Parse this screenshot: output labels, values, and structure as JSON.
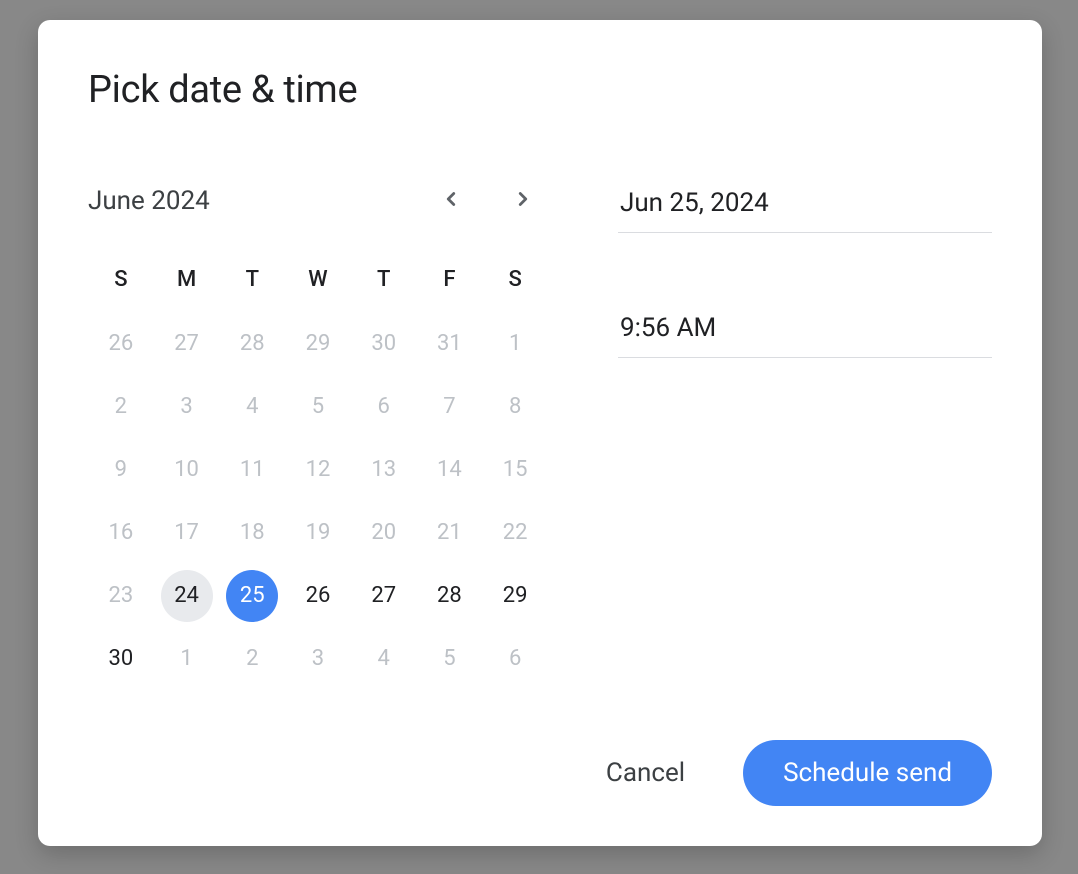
{
  "dialog": {
    "title": "Pick date & time"
  },
  "calendar": {
    "month_year": "June 2024",
    "day_headers": [
      "S",
      "M",
      "T",
      "W",
      "T",
      "F",
      "S"
    ],
    "days": [
      {
        "d": "26",
        "state": "muted"
      },
      {
        "d": "27",
        "state": "muted"
      },
      {
        "d": "28",
        "state": "muted"
      },
      {
        "d": "29",
        "state": "muted"
      },
      {
        "d": "30",
        "state": "muted"
      },
      {
        "d": "31",
        "state": "muted"
      },
      {
        "d": "1",
        "state": "muted"
      },
      {
        "d": "2",
        "state": "muted"
      },
      {
        "d": "3",
        "state": "muted"
      },
      {
        "d": "4",
        "state": "muted"
      },
      {
        "d": "5",
        "state": "muted"
      },
      {
        "d": "6",
        "state": "muted"
      },
      {
        "d": "7",
        "state": "muted"
      },
      {
        "d": "8",
        "state": "muted"
      },
      {
        "d": "9",
        "state": "muted"
      },
      {
        "d": "10",
        "state": "muted"
      },
      {
        "d": "11",
        "state": "muted"
      },
      {
        "d": "12",
        "state": "muted"
      },
      {
        "d": "13",
        "state": "muted"
      },
      {
        "d": "14",
        "state": "muted"
      },
      {
        "d": "15",
        "state": "muted"
      },
      {
        "d": "16",
        "state": "muted"
      },
      {
        "d": "17",
        "state": "muted"
      },
      {
        "d": "18",
        "state": "muted"
      },
      {
        "d": "19",
        "state": "muted"
      },
      {
        "d": "20",
        "state": "muted"
      },
      {
        "d": "21",
        "state": "muted"
      },
      {
        "d": "22",
        "state": "muted"
      },
      {
        "d": "23",
        "state": "muted"
      },
      {
        "d": "24",
        "state": "today"
      },
      {
        "d": "25",
        "state": "selected"
      },
      {
        "d": "26",
        "state": "active"
      },
      {
        "d": "27",
        "state": "active"
      },
      {
        "d": "28",
        "state": "active"
      },
      {
        "d": "29",
        "state": "active"
      },
      {
        "d": "30",
        "state": "active"
      },
      {
        "d": "1",
        "state": "muted"
      },
      {
        "d": "2",
        "state": "muted"
      },
      {
        "d": "3",
        "state": "muted"
      },
      {
        "d": "4",
        "state": "muted"
      },
      {
        "d": "5",
        "state": "muted"
      },
      {
        "d": "6",
        "state": "muted"
      }
    ]
  },
  "inputs": {
    "date_value": "Jun 25, 2024",
    "time_value": "9:56 AM"
  },
  "actions": {
    "cancel_label": "Cancel",
    "schedule_label": "Schedule send"
  }
}
